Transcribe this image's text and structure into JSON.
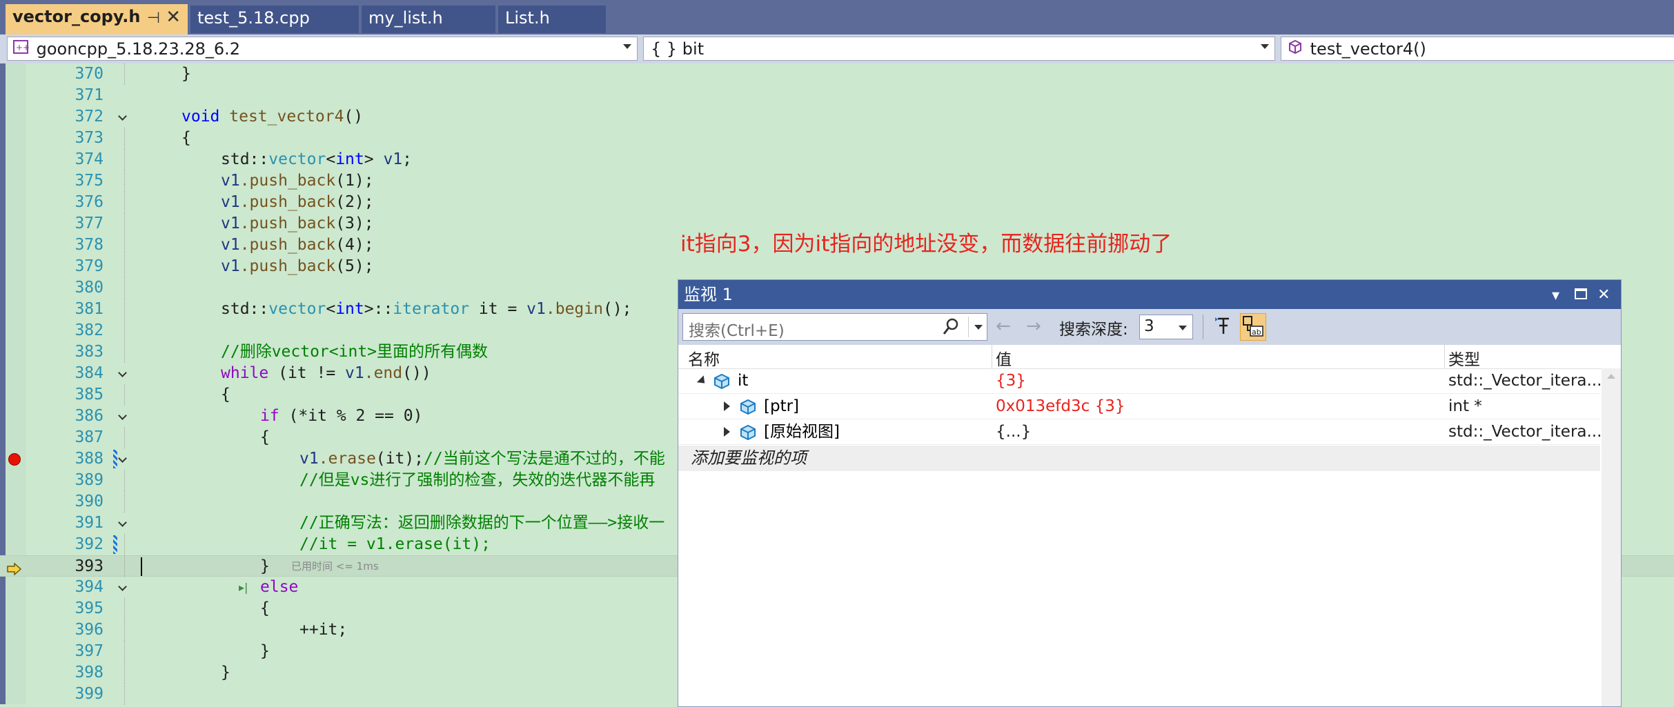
{
  "tabs": [
    {
      "label": "vector_copy.h",
      "active": true
    },
    {
      "label": "test_5.18.cpp",
      "active": false
    },
    {
      "label": "my_list.h",
      "active": false
    },
    {
      "label": "List.h",
      "active": false
    }
  ],
  "navbar": {
    "project": "gooncpp_5.18.23.28_6.2",
    "scope": "{ } bit",
    "function": "test_vector4()"
  },
  "lines": {
    "370": "370",
    "371": "371",
    "372": "372",
    "373": "373",
    "374": "374",
    "375": "375",
    "376": "376",
    "377": "377",
    "378": "378",
    "379": "379",
    "380": "380",
    "381": "381",
    "382": "382",
    "383": "383",
    "384": "384",
    "385": "385",
    "386": "386",
    "387": "387",
    "388": "388",
    "389": "389",
    "390": "390",
    "391": "391",
    "392": "392",
    "393": "393",
    "394": "394",
    "395": "395",
    "396": "396",
    "397": "397",
    "398": "398",
    "399": "399"
  },
  "code": {
    "l370": "}",
    "l372_kw": "void",
    "l372_fn": "test_vector4",
    "l372_rest": "()",
    "l373": "{",
    "l374_a": "std::",
    "l374_tp": "vector",
    "l374_b": "<",
    "l374_kw": "int",
    "l374_c": "> ",
    "l374_var": "v1",
    "l374_d": ";",
    "l375_var": "v1",
    "l375_fn": ".push_back",
    "l375_rest": "(1);",
    "l376_var": "v1",
    "l376_fn": ".push_back",
    "l376_rest": "(2);",
    "l377_var": "v1",
    "l377_fn": ".push_back",
    "l377_rest": "(3);",
    "l378_var": "v1",
    "l378_fn": ".push_back",
    "l378_rest": "(4);",
    "l379_var": "v1",
    "l379_fn": ".push_back",
    "l379_rest": "(5);",
    "l381_a": "std::",
    "l381_tp": "vector",
    "l381_b": "<",
    "l381_kw": "int",
    "l381_c": ">::",
    "l381_tp2": "iterator",
    "l381_d": " it = ",
    "l381_var": "v1",
    "l381_fn": ".begin",
    "l381_e": "();",
    "l383": "//删除vector<int>里面的所有偶数",
    "l384_kw": "while",
    "l384_a": " (it != ",
    "l384_var": "v1",
    "l384_fn": ".end",
    "l384_b": "())",
    "l385": "{",
    "l386_kw": "if",
    "l386_a": " (*it % 2 == 0)",
    "l387": "{",
    "l388_var": "v1",
    "l388_fn": ".erase",
    "l388_a": "(it);",
    "l388_cm": "//当前这个写法是通不过的，不能",
    "l389": "//但是vs进行了强制的检查，失效的迭代器不能再",
    "l391": "//正确写法：返回删除数据的下一个位置——>接收一",
    "l392": "//it = v1.erase(it);",
    "l393": "}",
    "l393_elapsed": "已用时间 <= 1ms",
    "l394_kw": "else",
    "l395": "{",
    "l396": "++it;",
    "l397": "}",
    "l398": "}"
  },
  "annotation": "it指向3，因为it指向的地址没变，而数据往前挪动了",
  "watch": {
    "title": "监视 1",
    "search_placeholder": "搜索(Ctrl+E)",
    "depth_label": "搜索深度:",
    "depth_value": "3",
    "columns": {
      "name": "名称",
      "value": "值",
      "type": "类型"
    },
    "rows": [
      {
        "name": "it",
        "value": "{3}",
        "type": "std::_Vector_itera..."
      },
      {
        "name": "[ptr]",
        "value": "0x013efd3c {3}",
        "type": "int *"
      },
      {
        "name": "[原始视图]",
        "value": "{...}",
        "type": "std::_Vector_itera..."
      }
    ],
    "add_item": "添加要监视的项"
  },
  "colors": {
    "editor_bg": "#cce8cf",
    "active_tab": "#f5cc84",
    "chrome": "#5d6b99",
    "annotation": "#e8231e",
    "breakpoint": "#e51400"
  }
}
